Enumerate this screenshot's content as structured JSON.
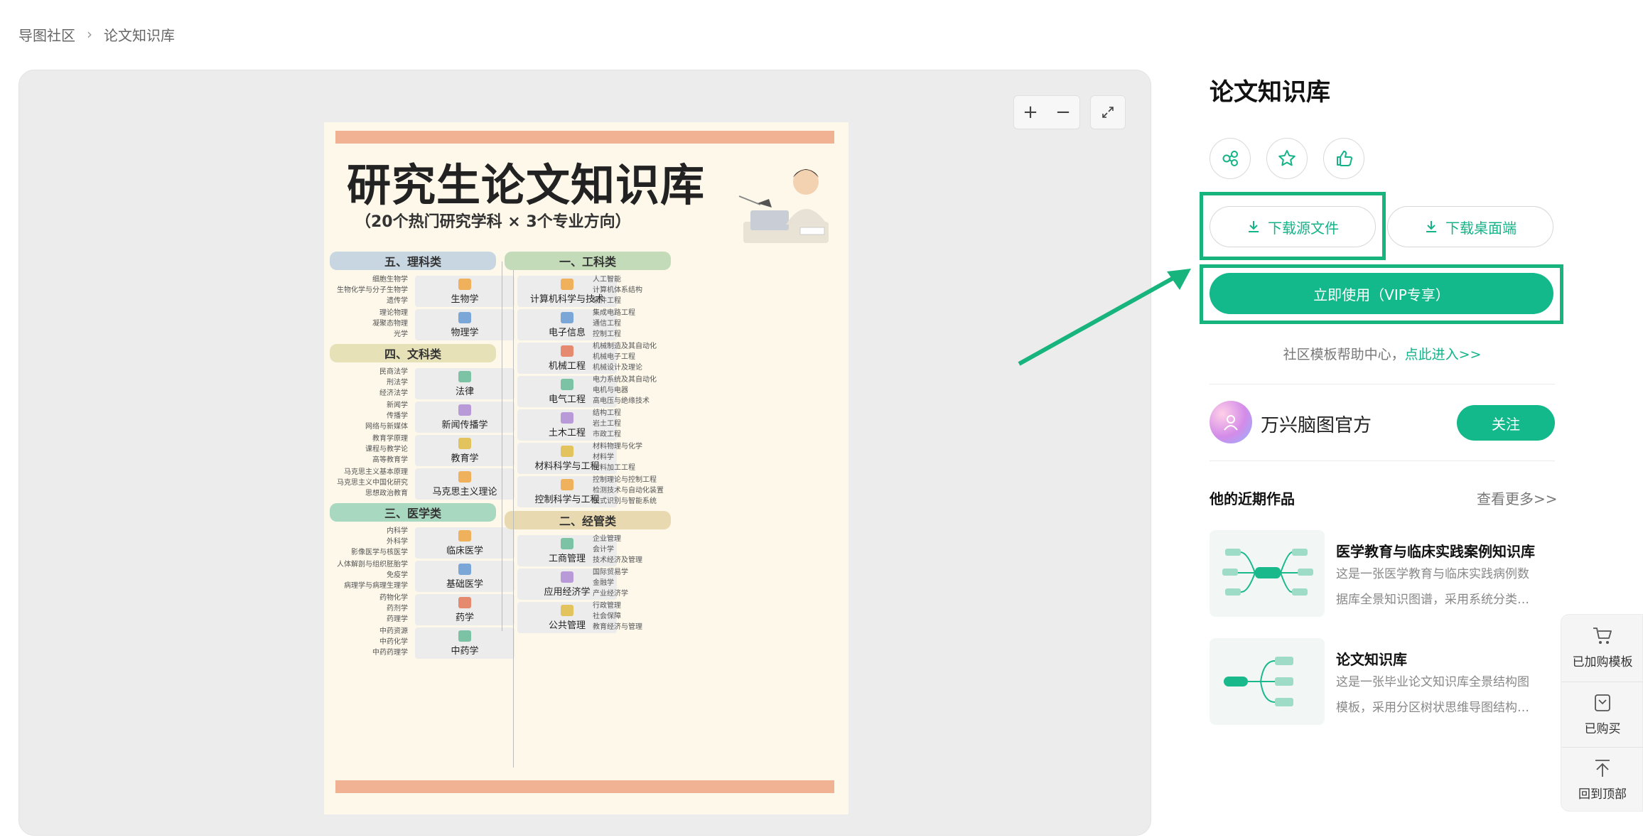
{
  "breadcrumb": {
    "root": "导图社区",
    "current": "论文知识库"
  },
  "preview": {
    "zoom_in": "+",
    "zoom_out": "−",
    "poster": {
      "title": "研究生论文知识库",
      "subtitle": "（20个热门研究学科 × 3个专业方向）",
      "left": [
        {
          "category": "五、理科类",
          "color": "#c8d6e2",
          "nodes": [
            {
              "name": "生物学",
              "leaves": [
                "细胞生物学",
                "生物化学与分子生物学",
                "遗传学"
              ]
            },
            {
              "name": "物理学",
              "leaves": [
                "理论物理",
                "凝聚态物理",
                "光学"
              ]
            }
          ]
        },
        {
          "category": "四、文科类",
          "color": "#e6e1b6",
          "nodes": [
            {
              "name": "法律",
              "leaves": [
                "民商法学",
                "刑法学",
                "经济法学"
              ]
            },
            {
              "name": "新闻传播学",
              "leaves": [
                "新闻学",
                "传播学",
                "网络与新媒体"
              ]
            },
            {
              "name": "教育学",
              "leaves": [
                "教育学原理",
                "课程与教学论",
                "高等教育学"
              ]
            },
            {
              "name": "马克思主义理论",
              "leaves": [
                "马克思主义基本原理",
                "马克思主义中国化研究",
                "思想政治教育"
              ]
            }
          ]
        },
        {
          "category": "三、医学类",
          "color": "#a9d8c1",
          "nodes": [
            {
              "name": "临床医学",
              "leaves": [
                "内科学",
                "外科学",
                "影像医学与核医学"
              ]
            },
            {
              "name": "基础医学",
              "leaves": [
                "人体解剖与组织胚胎学",
                "免疫学",
                "病理学与病理生理学"
              ]
            },
            {
              "name": "药学",
              "leaves": [
                "药物化学",
                "药剂学",
                "药理学"
              ]
            },
            {
              "name": "中药学",
              "leaves": [
                "中药资源",
                "中药化学",
                "中药药理学"
              ]
            }
          ]
        }
      ],
      "right": [
        {
          "category": "一、工科类",
          "color": "#c4dbba",
          "nodes": [
            {
              "name": "计算机科学与技术",
              "leaves": [
                "人工智能",
                "计算机体系结构",
                "软件工程"
              ]
            },
            {
              "name": "电子信息",
              "leaves": [
                "集成电路工程",
                "通信工程",
                "控制工程"
              ]
            },
            {
              "name": "机械工程",
              "leaves": [
                "机械制造及其自动化",
                "机械电子工程",
                "机械设计及理论"
              ]
            },
            {
              "name": "电气工程",
              "leaves": [
                "电力系统及其自动化",
                "电机与电器",
                "高电压与绝缘技术"
              ]
            },
            {
              "name": "土木工程",
              "leaves": [
                "结构工程",
                "岩土工程",
                "市政工程"
              ]
            },
            {
              "name": "材料科学与工程",
              "leaves": [
                "材料物理与化学",
                "材料学",
                "材料加工工程"
              ]
            },
            {
              "name": "控制科学与工程",
              "leaves": [
                "控制理论与控制工程",
                "检测技术与自动化装置",
                "模式识别与智能系统"
              ]
            }
          ]
        },
        {
          "category": "二、经管类",
          "color": "#e8d9b0",
          "nodes": [
            {
              "name": "工商管理",
              "leaves": [
                "企业管理",
                "会计学",
                "技术经济及管理"
              ]
            },
            {
              "name": "应用经济学",
              "leaves": [
                "国际贸易学",
                "金融学",
                "产业经济学"
              ]
            },
            {
              "name": "公共管理",
              "leaves": [
                "行政管理",
                "社会保障",
                "教育经济与管理"
              ]
            }
          ]
        }
      ]
    }
  },
  "sidebar": {
    "title": "论文知识库",
    "download_source": "下载源文件",
    "download_desktop": "下载桌面端",
    "use_now": "立即使用（VIP专享）",
    "help_text": "社区模板帮助中心，",
    "help_link": "点此进入>>",
    "author": "万兴脑图官方",
    "follow": "关注",
    "recent_title": "他的近期作品",
    "more": "查看更多>>",
    "works": [
      {
        "title": "医学教育与临床实践案例知识库",
        "desc1": "这是一张医学教育与临床实践病例数",
        "desc2": "据库全景知识图谱，采用系统分类…"
      },
      {
        "title": "论文知识库",
        "desc1": "这是一张毕业论文知识库全景结构图",
        "desc2": "模板，采用分区树状思维导图结构…"
      }
    ]
  },
  "dock": {
    "cart": "已加购模板",
    "bought": "已购买",
    "top": "回到顶部"
  },
  "colors": {
    "accent": "#13b98b",
    "highlight": "#17b57d"
  }
}
